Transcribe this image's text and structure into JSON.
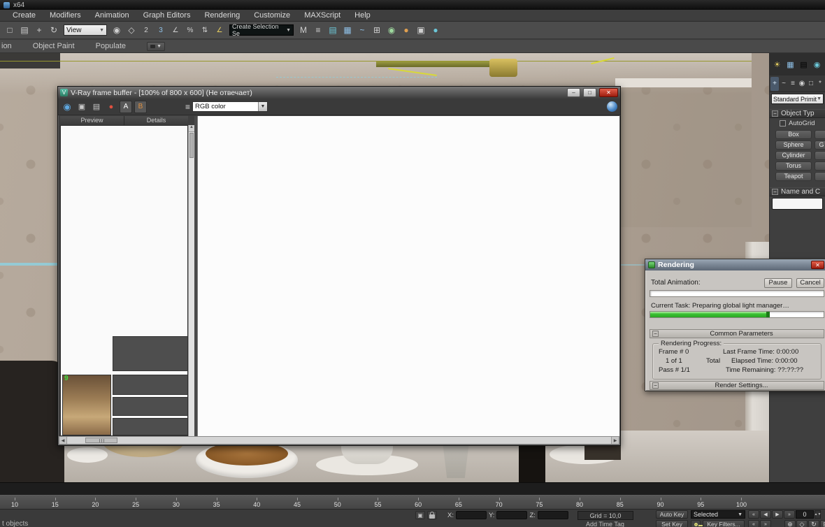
{
  "titlebar": {
    "label": "x64"
  },
  "menubar": {
    "items": [
      "Create",
      "Modifiers",
      "Animation",
      "Graph Editors",
      "Rendering",
      "Customize",
      "MAXScript",
      "Help"
    ]
  },
  "toolbar": {
    "view_label": "View",
    "selection_set_label": "Create Selection Se"
  },
  "ribbon": {
    "items": [
      "ion",
      "Object Paint",
      "Populate"
    ]
  },
  "vfb": {
    "title": "V-Ray frame buffer - [100% of 800 x 600] (Не отвечает)",
    "channel": "RGB color",
    "tab_preview": "Preview",
    "tab_details": "Details",
    "history_badge": "9"
  },
  "render_dialog": {
    "title": "Rendering",
    "total_animation": "Total Animation:",
    "pause": "Pause",
    "cancel": "Cancel",
    "current_task": "Current Task:   Preparing global light manager…",
    "rollout_common": "Common Parameters",
    "progress_title": "Rendering Progress:",
    "frame": "Frame # 0",
    "of": "1 of 1",
    "total": "Total",
    "pass": "Pass #  1/1",
    "last_frame_time": "Last Frame Time:  0:00:00",
    "elapsed_time": "Elapsed Time:  0:00:00",
    "time_remaining": "Time Remaining: ??:??:??",
    "rollout_render_settings": "Render Settings..."
  },
  "command_panel": {
    "category": "Standard Primitives",
    "rollout_object_type": "Object Typ",
    "autogrid": "AutoGrid",
    "buttons": [
      "Box",
      "Sphere",
      "Cylinder",
      "Torus",
      "Teapot"
    ],
    "partial_button": "G",
    "rollout_name": "Name and C"
  },
  "timeline": {
    "ticks": [
      "10",
      "15",
      "20",
      "25",
      "30",
      "35",
      "40",
      "45",
      "50",
      "55",
      "60",
      "65",
      "70",
      "75",
      "80",
      "85",
      "90",
      "95",
      "100"
    ]
  },
  "statusbar": {
    "prompt": "t objects",
    "x": "X:",
    "y": "Y:",
    "z": "Z:",
    "grid": "Grid = 10,0",
    "auto_key": "Auto Key",
    "selected": "Selected",
    "set_key": "Set Key",
    "key_filters": "Key Filters...",
    "add_time_tag": "Add Time Tag",
    "frame_field": "0"
  },
  "colors": {
    "progress_green": "#2aa622",
    "close_red": "#9c1c0e",
    "viewport_highlight": "#97972e"
  }
}
